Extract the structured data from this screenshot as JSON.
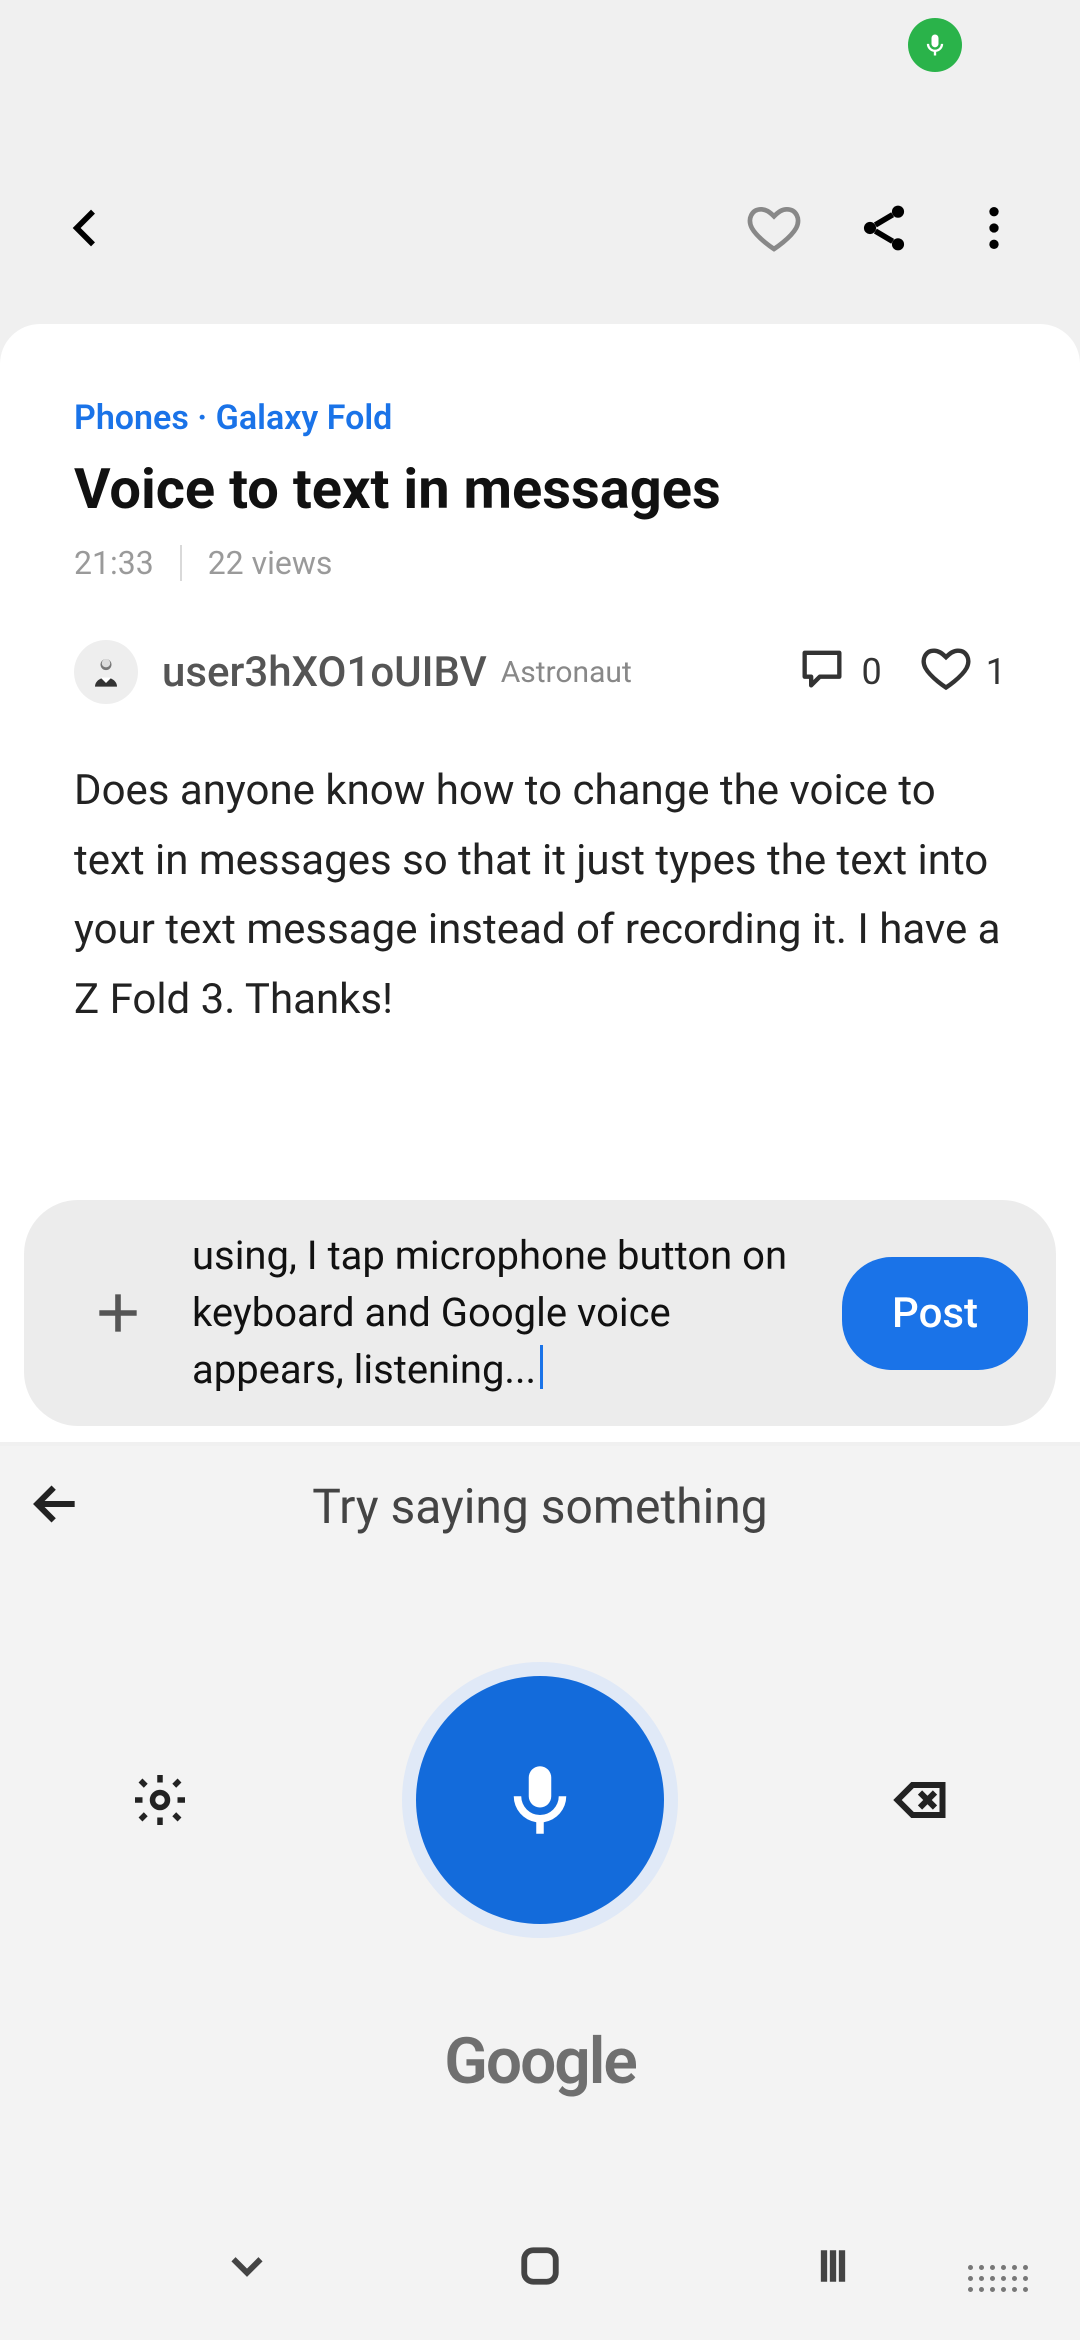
{
  "breadcrumb": {
    "a": "Phones",
    "sep": "·",
    "b": "Galaxy Fold"
  },
  "post": {
    "title": "Voice to text in messages",
    "time": "21:33",
    "views": "22 views",
    "author": "user3hXO1oUIBV",
    "rank": "Astronaut",
    "comments": "0",
    "likes": "1",
    "body": "Does anyone know how to change the voice to text in messages so that it just types the text into your text message instead of recording it. I have a Z Fold 3. Thanks!"
  },
  "reply": {
    "text": "using, I tap microphone button on keyboard and Google voice appears, listening...",
    "post_btn": "Post"
  },
  "voice": {
    "prompt": "Try saying something",
    "brand": "Google"
  }
}
